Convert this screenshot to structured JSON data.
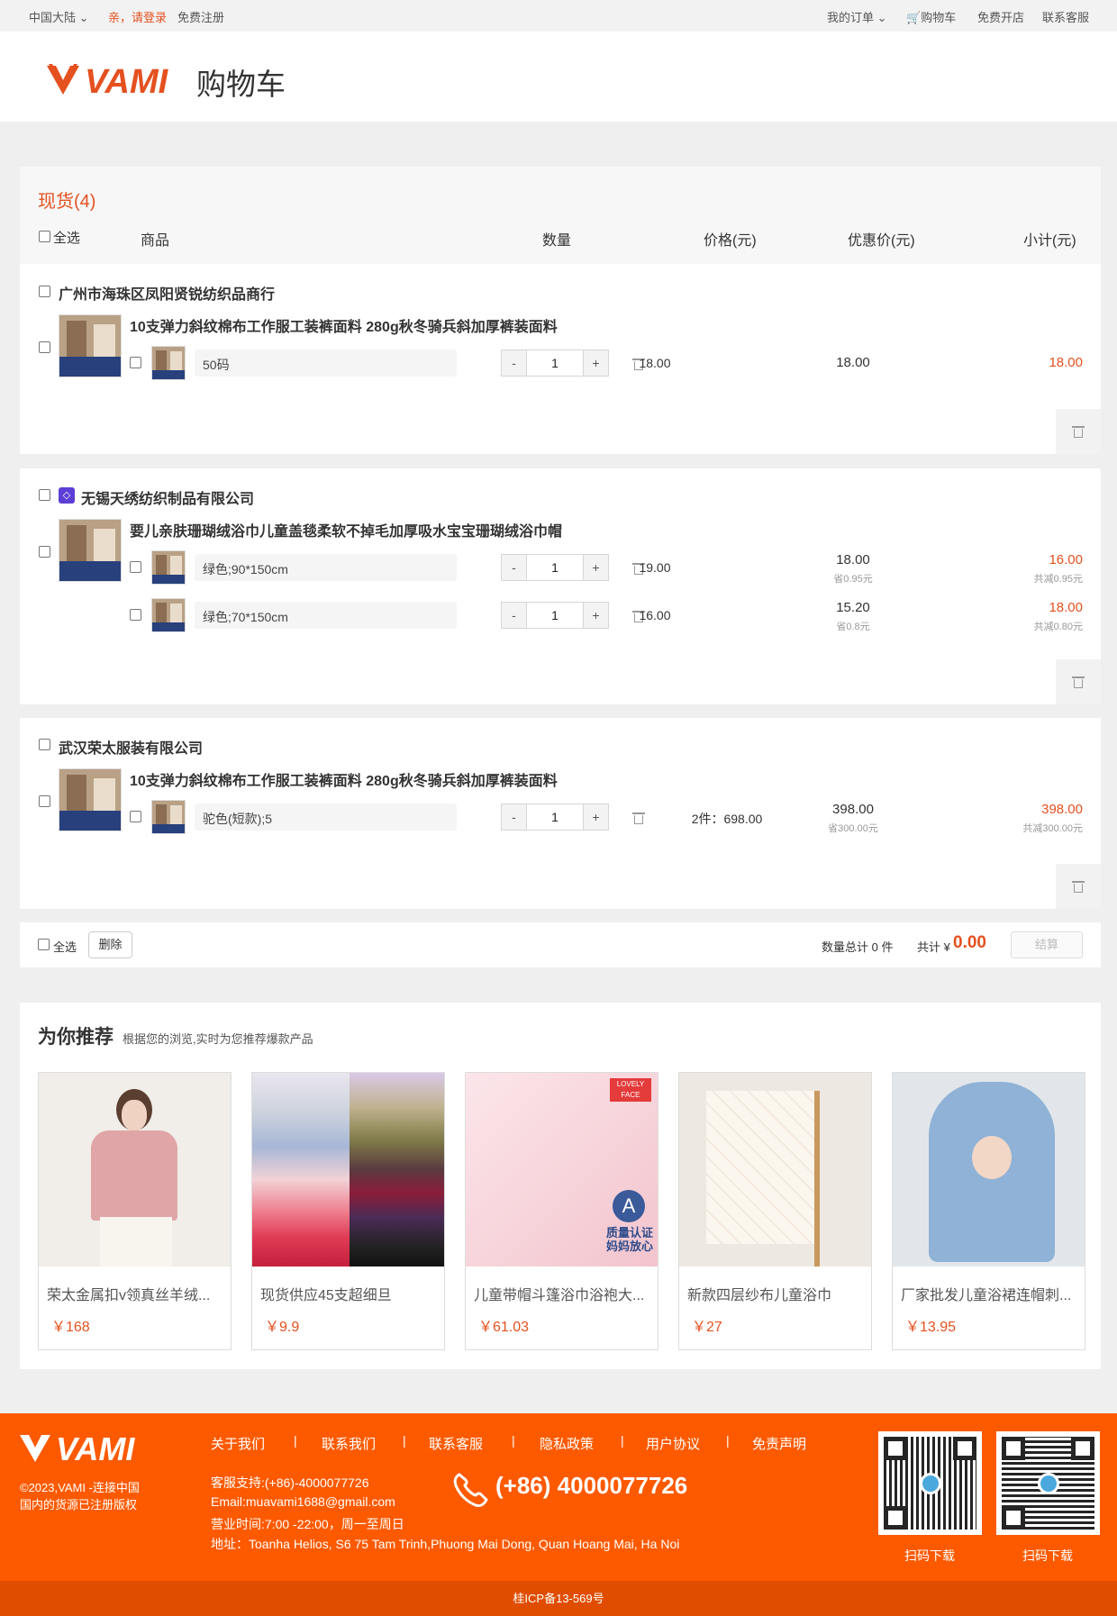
{
  "topbar": {
    "region": "中国大陆",
    "login": "亲，请登录",
    "register": "免费注册",
    "orders": "我的订单",
    "cart": "购物车",
    "open_shop": "免费开店",
    "service": "联系客服"
  },
  "header": {
    "brand": "VAMI",
    "title": "购物车"
  },
  "cart": {
    "heading": "现货(4)",
    "cols": {
      "select_all": "全选",
      "product": "商品",
      "qty": "数量",
      "price": "价格(元)",
      "discount": "优惠价(元)",
      "subtotal": "小计(元)"
    },
    "shops": [
      {
        "name": "广州市海珠区凤阳贤锐纺织品商行",
        "product": "10支弹力斜纹棉布工作服工装裤面料 280g秋冬骑兵斜加厚裤装面料",
        "items": [
          {
            "spec": "50码",
            "qty": "1",
            "price": "18.00",
            "discount": "18.00",
            "discount_note": "",
            "subtotal": "18.00",
            "subtotal_note": ""
          }
        ]
      },
      {
        "name": "无锡天绣纺织制品有限公司",
        "product": "要儿亲肤珊瑚绒浴巾儿童盖毯柔软不掉毛加厚吸水宝宝珊瑚绒浴巾帽",
        "items": [
          {
            "spec": "绿色;90*150cm",
            "qty": "1",
            "price": "19.00",
            "discount": "18.00",
            "discount_note": "省0.95元",
            "subtotal": "16.00",
            "subtotal_note": "共减0.95元"
          },
          {
            "spec": "绿色;70*150cm",
            "qty": "1",
            "price": "16.00",
            "discount": "15.20",
            "discount_note": "省0.8元",
            "subtotal": "18.00",
            "subtotal_note": "共减0.80元"
          }
        ]
      },
      {
        "name": "武汉荣太服装有限公司",
        "product": "10支弹力斜纹棉布工作服工装裤面料 280g秋冬骑兵斜加厚裤装面料",
        "items": [
          {
            "spec": "驼色(短款);5",
            "qty": "1",
            "price": "2件：698.00",
            "discount": "398.00",
            "discount_note": "省300.00元",
            "subtotal": "398.00",
            "subtotal_note": "共减300.00元"
          }
        ]
      }
    ],
    "qty_minus": "-",
    "qty_plus": "+"
  },
  "footer_bar": {
    "select_all": "全选",
    "delete": "删除",
    "count": "数量总计 0 件",
    "total_label": "共计 ¥",
    "total": "0.00",
    "checkout": "结算"
  },
  "recommend": {
    "title": "为你推荐",
    "subtitle": "根据您的浏览,实时为您推荐爆款产品",
    "items": [
      {
        "name": "荣太金属扣v领真丝羊绒...",
        "price": "￥168"
      },
      {
        "name": "现货供应45支超细旦",
        "price": "￥9.9"
      },
      {
        "name": "儿童带帽斗篷浴巾浴袍大...",
        "price": "￥61.03"
      },
      {
        "name": "新款四层纱布儿童浴巾",
        "price": "￥27"
      },
      {
        "name": "厂家批发儿童浴裙连帽刺...",
        "price": "￥13.95"
      }
    ],
    "badge_text": "LOVELY FACE",
    "badge_letter": "A",
    "badge_caption1": "质量认证",
    "badge_caption2": "妈妈放心"
  },
  "footer": {
    "copyright1": "©2023,VAMI -连接中国",
    "copyright2": "国内的货源已注册版权",
    "links": [
      "关于我们",
      "联系我们",
      "联系客服",
      "隐私政策",
      "用户协议",
      "免责声明"
    ],
    "support": "客服支持:(+86)-4000077726",
    "email": "Email:muavami1688@gmail.com",
    "hours": "营业时间:7:00 -22:00，周一至周日",
    "address": "地址：Toanha Helios, S6 75 Tam Trinh,Phuong Mai Dong, Quan Hoang Mai, Ha Noi",
    "phone": "(+86) 4000077726",
    "qr1": "扫码下载",
    "qr2": "扫码下载",
    "icp": "桂ICP备13-569号"
  },
  "colors": {
    "accent": "#e4511f",
    "footer": "#fd5a00"
  }
}
